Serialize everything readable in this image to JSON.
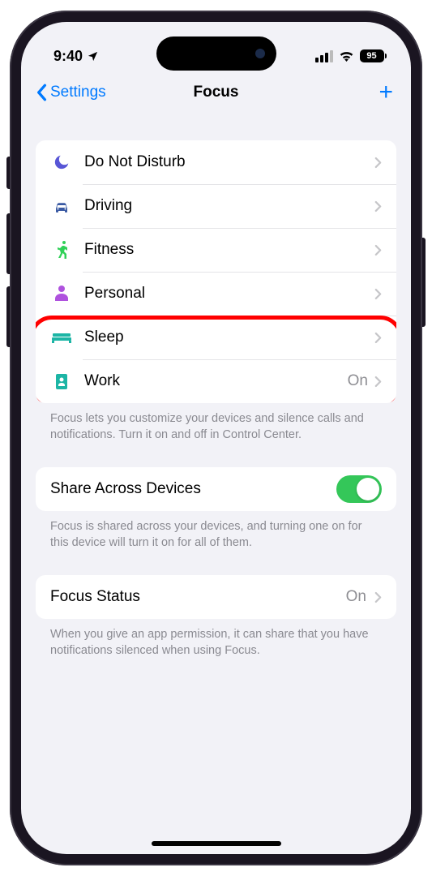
{
  "status": {
    "time": "9:40",
    "battery": "95"
  },
  "nav": {
    "back": "Settings",
    "title": "Focus"
  },
  "modes": [
    {
      "label": "Do Not Disturb",
      "icon": "moon",
      "color": "#5856d6",
      "status": ""
    },
    {
      "label": "Driving",
      "icon": "car",
      "color": "#3a5aa3",
      "status": ""
    },
    {
      "label": "Fitness",
      "icon": "runner",
      "color": "#30d158",
      "status": ""
    },
    {
      "label": "Personal",
      "icon": "person",
      "color": "#af52de",
      "status": ""
    },
    {
      "label": "Sleep",
      "icon": "bed",
      "color": "#1cb5a5",
      "status": ""
    },
    {
      "label": "Work",
      "icon": "badge",
      "color": "#1cb5a5",
      "status": "On"
    }
  ],
  "modesFooter": "Focus lets you customize your devices and silence calls and notifications. Turn it on and off in Control Center.",
  "share": {
    "label": "Share Across Devices",
    "enabled": true,
    "footer": "Focus is shared across your devices, and turning one on for this device will turn it on for all of them."
  },
  "focusStatus": {
    "label": "Focus Status",
    "value": "On",
    "footer": "When you give an app permission, it can share that you have notifications silenced when using Focus."
  }
}
